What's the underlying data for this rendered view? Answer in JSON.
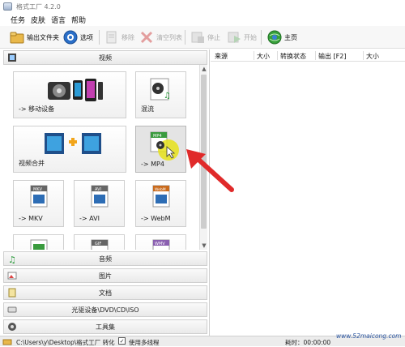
{
  "window": {
    "title": "格式工厂 4.2.0"
  },
  "menu": {
    "items": [
      "任务",
      "皮肤",
      "语言",
      "帮助"
    ]
  },
  "toolbar": {
    "output_folder": "输出文件夹",
    "options": "选项",
    "remove": "移除",
    "clear_list": "清空列表",
    "stop": "停止",
    "start": "开始",
    "home": "主页"
  },
  "left": {
    "video_section": "视频",
    "tiles": [
      {
        "label": "-> 移动设备"
      },
      {
        "label": "混流"
      },
      {
        "label": "视频合并"
      },
      {
        "label": "-> MP4",
        "badge": "MP4"
      },
      {
        "label": "-> MKV",
        "badge": "MKV"
      },
      {
        "label": "-> AVI",
        "badge": "AVI"
      },
      {
        "label": "-> WebM",
        "badge": "WebM"
      },
      {
        "label": "",
        "badge": ""
      },
      {
        "label": "",
        "badge": "GIF"
      },
      {
        "label": "",
        "badge": "WMV"
      }
    ],
    "sections": [
      "音频",
      "图片",
      "文档",
      "光驱设备\\DVD\\CD\\ISO",
      "工具集"
    ]
  },
  "list": {
    "columns": [
      "来源",
      "大小",
      "转换状态",
      "输出 [F2]",
      "大小"
    ]
  },
  "status": {
    "path": "C:\\Users\\y\\Desktop\\格式工厂 转化",
    "multithread": "使用多线程",
    "elapsed_label": "耗时：00:00:00",
    "watermark": "www.52maicong.com"
  },
  "colors": {
    "accent_arrow": "#e02a2a",
    "mp4_highlight": "#e6e21a"
  }
}
